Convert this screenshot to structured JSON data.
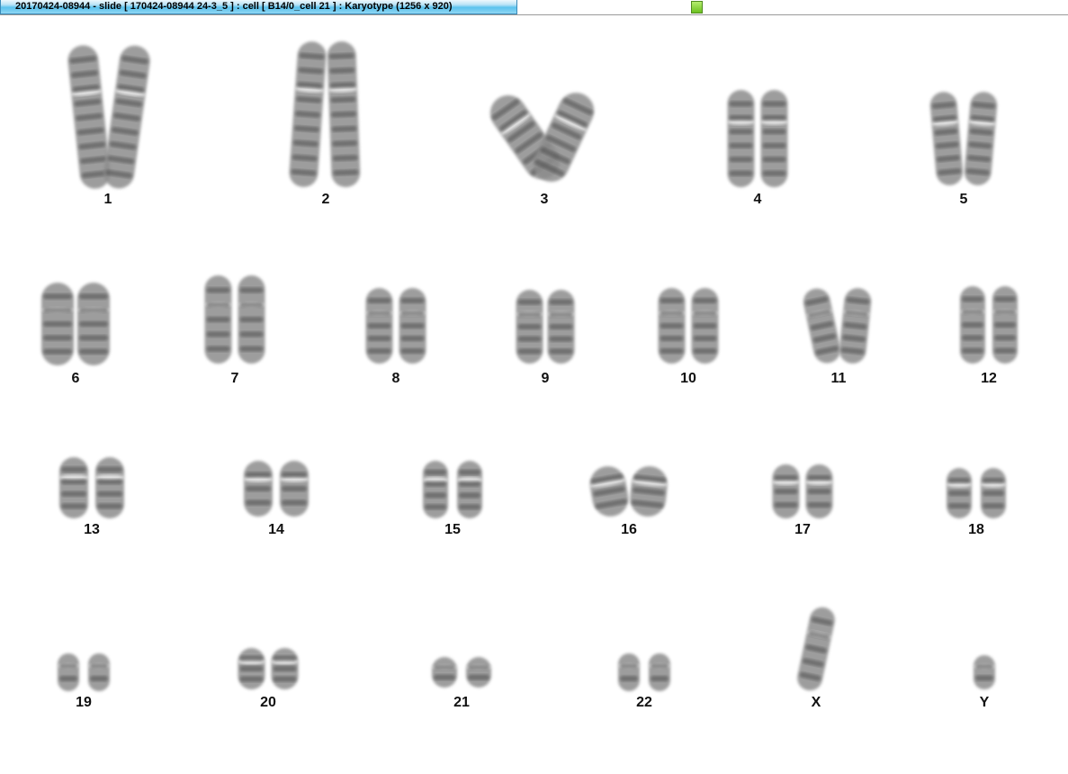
{
  "window": {
    "title": "20170424-08944 - slide [ 170424-08944 24-3_5 ] : cell [ B14/0_cell 21 ] : Karyotype  (1256 x 920)"
  },
  "colors": {
    "title_tab": "#5cc3ee",
    "status_indicator": "#7ccb2c",
    "chromosome_fill": "#8c8c8c",
    "chromosome_band": "#4a4a4a"
  },
  "karyotype": {
    "chromosomes": [
      {
        "label": "1"
      },
      {
        "label": "2"
      },
      {
        "label": "3"
      },
      {
        "label": "4"
      },
      {
        "label": "5"
      },
      {
        "label": "6"
      },
      {
        "label": "7"
      },
      {
        "label": "8"
      },
      {
        "label": "9"
      },
      {
        "label": "10"
      },
      {
        "label": "11"
      },
      {
        "label": "12"
      },
      {
        "label": "13"
      },
      {
        "label": "14"
      },
      {
        "label": "15"
      },
      {
        "label": "16"
      },
      {
        "label": "17"
      },
      {
        "label": "18"
      },
      {
        "label": "19"
      },
      {
        "label": "20"
      },
      {
        "label": "21"
      },
      {
        "label": "22"
      },
      {
        "label": "X"
      },
      {
        "label": "Y"
      }
    ]
  }
}
